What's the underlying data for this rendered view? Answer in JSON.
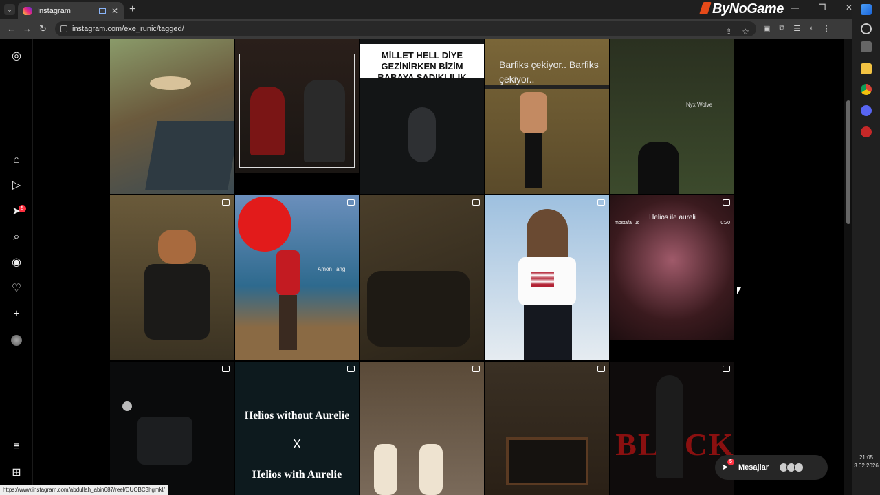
{
  "browser": {
    "tab_title": "Instagram",
    "url": "instagram.com/exe_runic/tagged/",
    "brand": "ByNoGame",
    "status_url": "https://www.instagram.com/abdullah_abin687/reel/DUOBC3hgmkl/"
  },
  "nav": {
    "notification_count": "5"
  },
  "tiles": [
    {
      "caption": ""
    },
    {
      "caption": ""
    },
    {
      "caption": "MİLLET HELL DİYE GEZİNİRKEN BİZİM BABAYA SADIKLILIK"
    },
    {
      "caption": "Barfiks çekiyor.. Barfiks çekiyor.."
    },
    {
      "caption": "Nyx Wolve"
    },
    {
      "caption": ""
    },
    {
      "caption": "Amon Tang"
    },
    {
      "caption": ""
    },
    {
      "caption": ""
    },
    {
      "caption": "Helios ile aureli",
      "user": "mostafa_uc_",
      "time": "0:20"
    },
    {
      "caption": ""
    },
    {
      "caption": "Helios without Aurelie",
      "mid": "X",
      "bottom": "Helios with Aurelie"
    },
    {
      "caption": ""
    },
    {
      "caption": ""
    },
    {
      "caption": "BLACK"
    }
  ],
  "messages": {
    "label": "Mesajlar",
    "badge": "5"
  },
  "clock": {
    "time": "21:05",
    "date": "3.02.2026"
  }
}
